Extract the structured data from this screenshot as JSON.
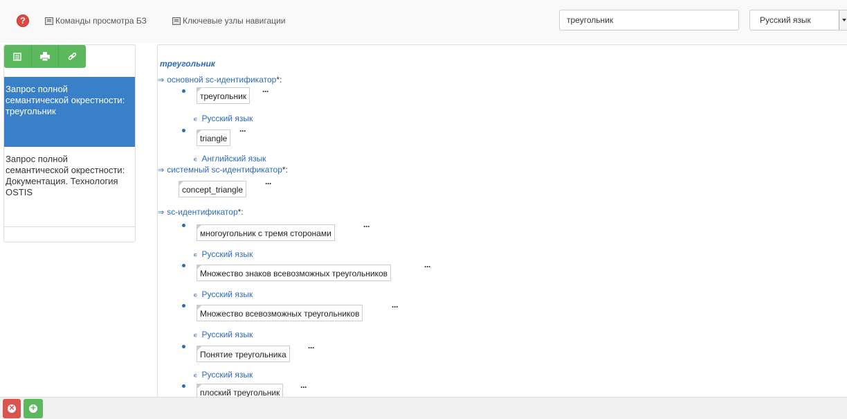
{
  "topbar": {
    "help_icon": "?",
    "menu_view_commands": "Команды просмотра БЗ",
    "menu_nav_nodes": "Ключевые узлы навигации",
    "search_value": "треугольник",
    "language_selected": "Русский язык"
  },
  "toolbar": {
    "icons": [
      "list-icon",
      "print-icon",
      "link-icon"
    ]
  },
  "history": [
    {
      "label": "Запрос полной семантической окрестности: треугольник",
      "active": true
    },
    {
      "label": "Запрос полной семантической окрестности: Документация. Технология OSTIS",
      "active": false
    }
  ],
  "content": {
    "title": "треугольник",
    "relations": {
      "main_id": "основной sc-идентификатор",
      "system_id": "системный sc-идентификатор",
      "sc_id": "sc-идентификатор",
      "star": "*:"
    },
    "main_ids": [
      {
        "value": "треугольник",
        "lang": "Русский язык"
      },
      {
        "value": "triangle",
        "lang": "Английский язык"
      }
    ],
    "system_id_value": "concept_triangle",
    "sc_ids": [
      {
        "value": "многоугольник с тремя сторонами",
        "lang": "Русский язык"
      },
      {
        "value": "Множество знаков всевозможных треугольников",
        "lang": "Русский язык"
      },
      {
        "value": "Множество всевозможных треугольников",
        "lang": "Русский язык"
      },
      {
        "value": "Понятие треугольника",
        "lang": "Русский язык"
      },
      {
        "value": "плоский треугольник",
        "lang": ""
      }
    ],
    "dots": "···"
  },
  "bottombar": {
    "close_icon": "close-icon",
    "add_icon": "add-icon"
  }
}
